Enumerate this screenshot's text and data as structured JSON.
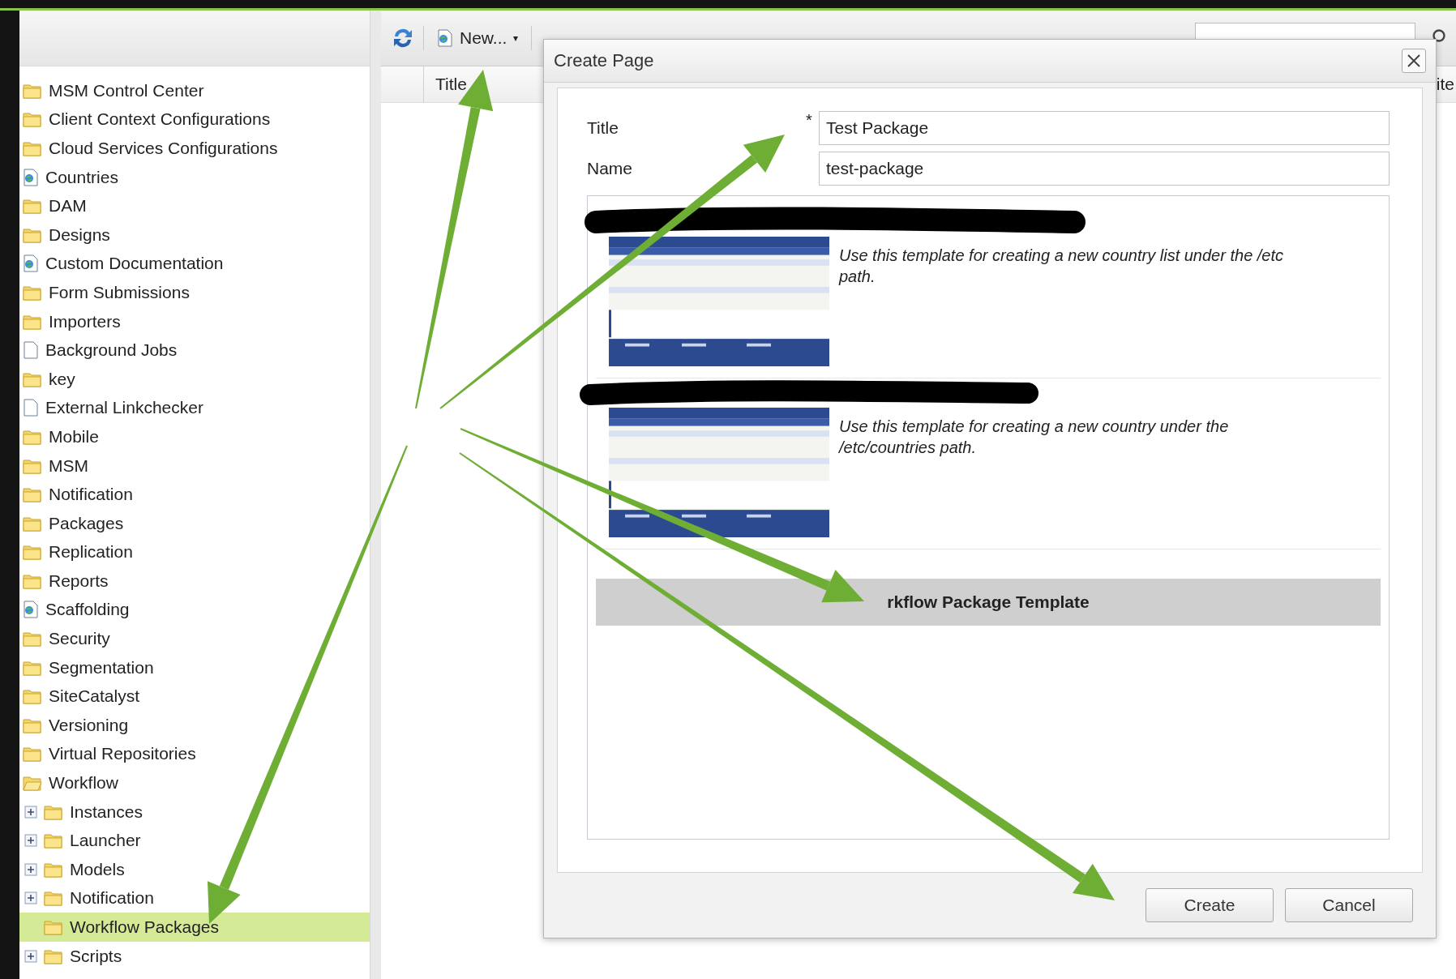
{
  "sidebar": {
    "items": [
      {
        "label": "MSM Control Center",
        "kind": "folder",
        "selected": false
      },
      {
        "label": "Client Context Configurations",
        "kind": "folder",
        "selected": false
      },
      {
        "label": "Cloud Services Configurations",
        "kind": "folder",
        "selected": false
      },
      {
        "label": "Countries",
        "kind": "page",
        "selected": false
      },
      {
        "label": "DAM",
        "kind": "folder",
        "selected": false
      },
      {
        "label": "Designs",
        "kind": "folder",
        "selected": false
      },
      {
        "label": "Custom Documentation",
        "kind": "page",
        "selected": false
      },
      {
        "label": "Form Submissions",
        "kind": "folder",
        "selected": false
      },
      {
        "label": "Importers",
        "kind": "folder",
        "selected": false
      },
      {
        "label": "Background Jobs",
        "kind": "document",
        "selected": false
      },
      {
        "label": "key",
        "kind": "folder",
        "selected": false
      },
      {
        "label": "External Linkchecker",
        "kind": "document",
        "selected": false
      },
      {
        "label": "Mobile",
        "kind": "folder",
        "selected": false
      },
      {
        "label": "MSM",
        "kind": "folder",
        "selected": false
      },
      {
        "label": "Notification",
        "kind": "folder",
        "selected": false
      },
      {
        "label": "Packages",
        "kind": "folder",
        "selected": false
      },
      {
        "label": "Replication",
        "kind": "folder",
        "selected": false
      },
      {
        "label": "Reports",
        "kind": "folder",
        "selected": false
      },
      {
        "label": "Scaffolding",
        "kind": "page",
        "selected": false
      },
      {
        "label": "Security",
        "kind": "folder",
        "selected": false
      },
      {
        "label": "Segmentation",
        "kind": "folder",
        "selected": false
      },
      {
        "label": "SiteCatalyst",
        "kind": "folder",
        "selected": false
      },
      {
        "label": "Versioning",
        "kind": "folder",
        "selected": false
      },
      {
        "label": "Virtual Repositories",
        "kind": "folder",
        "selected": false
      },
      {
        "label": "Workflow",
        "kind": "folder",
        "selected": false,
        "expanded": true,
        "children": [
          {
            "label": "Instances",
            "kind": "folder",
            "selected": false,
            "expanded": false
          },
          {
            "label": "Launcher",
            "kind": "folder",
            "selected": false,
            "expanded": false
          },
          {
            "label": "Models",
            "kind": "folder",
            "selected": false,
            "expanded": false
          },
          {
            "label": "Notification",
            "kind": "folder",
            "selected": false,
            "expanded": false
          },
          {
            "label": "Workflow Packages",
            "kind": "folder",
            "selected": true
          },
          {
            "label": "Scripts",
            "kind": "folder",
            "selected": false,
            "expanded": false
          }
        ]
      }
    ]
  },
  "toolbar": {
    "buttons": [
      {
        "kind": "refresh"
      },
      {
        "kind": "new",
        "label": "New...",
        "caret": "▾"
      }
    ]
  },
  "table": {
    "columns": [
      "Title",
      "ite"
    ]
  },
  "dialog": {
    "title": "Create Page",
    "fields": [
      {
        "label": "Title",
        "marker": "*",
        "value": "Test Package"
      },
      {
        "label": "Name",
        "value": "test-package"
      }
    ],
    "templates": [
      {
        "description": "Use this template for creating a new country list under the /etc path.",
        "selected": false
      },
      {
        "description": "Use this template for creating a new country under the /etc/countries path.",
        "selected": false
      },
      {
        "title": "rkflow Package Template",
        "selected": true
      }
    ],
    "buttons": [
      "Create",
      "Cancel"
    ]
  }
}
